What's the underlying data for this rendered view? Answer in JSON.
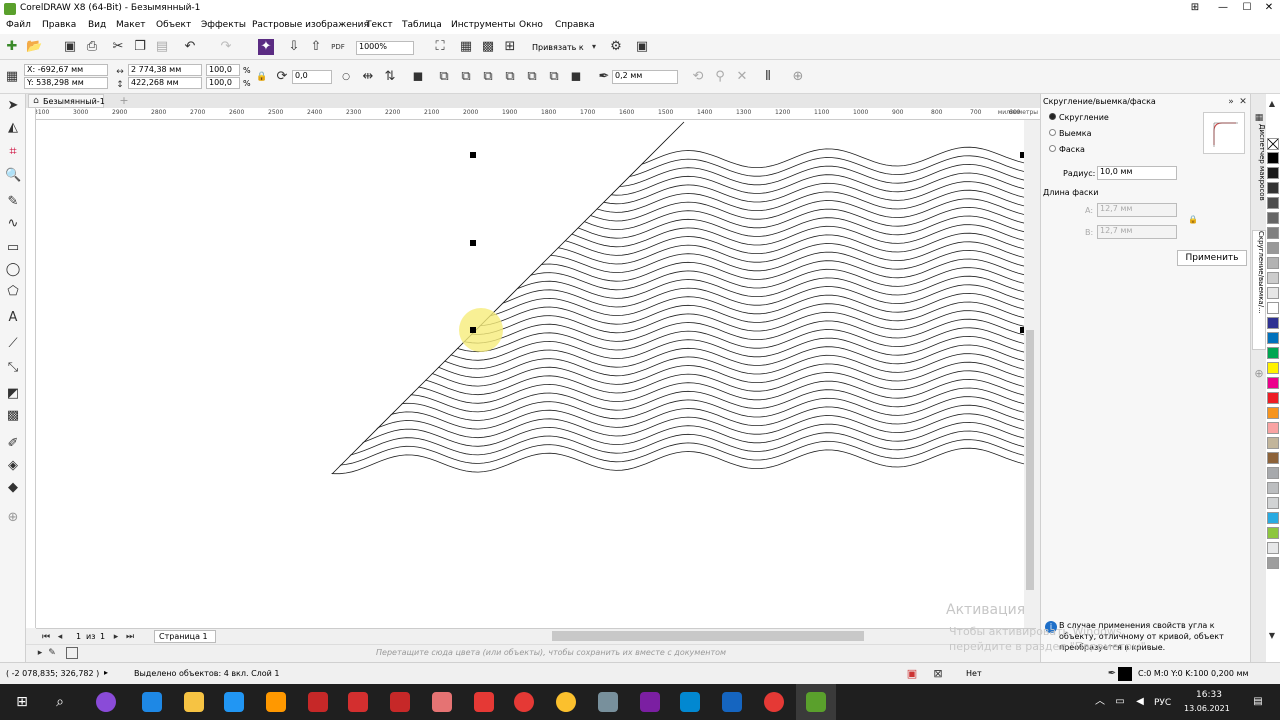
{
  "window": {
    "title": "CorelDRAW X8 (64-Bit) - Безымянный-1"
  },
  "menu": [
    "Файл",
    "Правка",
    "Вид",
    "Макет",
    "Объект",
    "Эффекты",
    "Растровые изображения",
    "Текст",
    "Таблица",
    "Инструменты",
    "Окно",
    "Справка"
  ],
  "standard_toolbar": {
    "zoom": "1000%",
    "snap_label": "Привязать к"
  },
  "property_bar": {
    "x": "X: -692,67 мм",
    "y": "Y: 538,298 мм",
    "w": "2 774,38 мм",
    "h": "422,268 мм",
    "sx": "100,0",
    "sy": "100,0",
    "pct": "%",
    "angle": "0,0",
    "outline": "0,2 мм"
  },
  "document_tab": "Безымянный-1",
  "ruler_ticks": [
    "3100",
    "3000",
    "2900",
    "2800",
    "2700",
    "2600",
    "2500",
    "2400",
    "2300",
    "2200",
    "2100",
    "2000",
    "1900",
    "1800",
    "1700",
    "1600",
    "1500",
    "1400",
    "1300",
    "1200",
    "1100",
    "1000",
    "900",
    "800",
    "700",
    "600",
    "500"
  ],
  "ruler_unit": "миллиметры",
  "page_nav": {
    "current": "1",
    "of": "из",
    "total": "1",
    "page_tab": "Страница 1"
  },
  "color_hint": "Перетащите сюда цвета (или объекты), чтобы сохранить их вместе с документом",
  "status": {
    "coords": "( -2 078,835; 326,782 )",
    "selection": "Выделено объектов: 4 вкл. Слой 1",
    "fill": "Нет",
    "outline_info": "C:0 M:0 Y:0 K:100  0,200 мм"
  },
  "docker": {
    "title": "Скругление/выемка/фаска",
    "options": [
      "Скругление",
      "Выемка",
      "Фаска"
    ],
    "radius_label": "Радиус:",
    "radius_value": "10,0 мм",
    "chamfer_label": "Длина фаски",
    "a_label": "A:",
    "a_value": "12,7 мм",
    "b_label": "B:",
    "b_value": "12,7 мм",
    "apply": "Применить",
    "info": "В случае применения свойств угла к объекту, отличному от кривой, объект преобразуется в кривые.",
    "side_tabs": [
      "Диспетчер макросов",
      "Скругление/выемка/..."
    ]
  },
  "watermark": {
    "line1": "Активация Windows",
    "line2": "Чтобы активировать Windows, перейдите в раздел \"Параметры\"."
  },
  "tray": {
    "lang": "РУС",
    "time": "16:33",
    "date": "13.06.2021"
  },
  "palette_colors": [
    "#000000",
    "#1a1a1a",
    "#333333",
    "#4d4d4d",
    "#666666",
    "#808080",
    "#999999",
    "#b3b3b3",
    "#cccccc",
    "#e6e6e6",
    "#ffffff",
    "#2e3192",
    "#0071bc",
    "#00a651",
    "#fff200",
    "#ec008c",
    "#ed1c24",
    "#f7941d",
    "#f9a3a3",
    "#c2b59b",
    "#8c6239",
    "#a7a9ac",
    "#bcbec0",
    "#d1d3d4",
    "#29abe2",
    "#8dc63f",
    "#e6e7e8",
    "#9e9e9e"
  ],
  "accent": "#5aa02c"
}
